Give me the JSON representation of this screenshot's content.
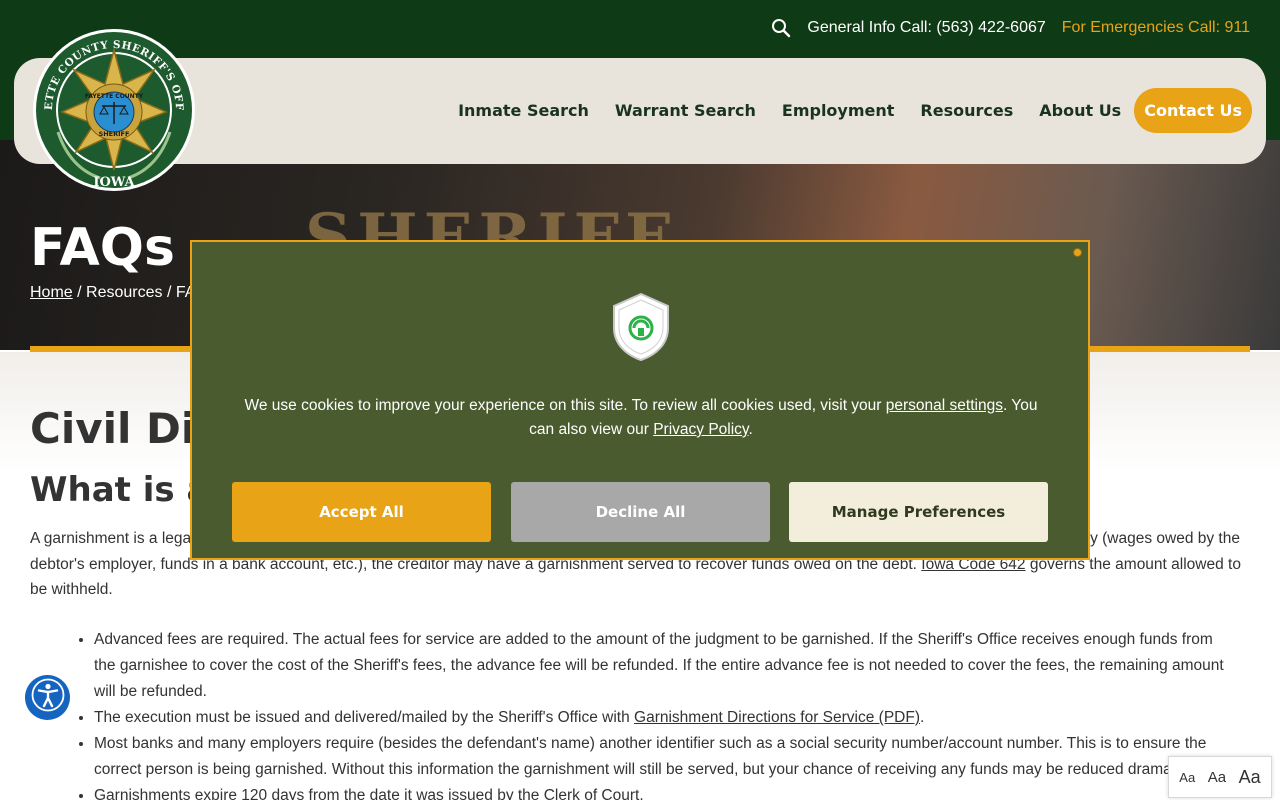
{
  "header": {
    "info_call": "General Info Call: (563) 422-6067",
    "emergency_call": "For Emergencies Call: 911",
    "search_icon": "search-icon"
  },
  "logo": {
    "top_text": "FAYETTE COUNTY SHERIFF'S OFFICE",
    "badge_top": "FAYETTE COUNTY",
    "badge_bottom": "SHERIFF",
    "bottom_text": "IOWA"
  },
  "nav": {
    "items": [
      "Inmate Search",
      "Warrant Search",
      "Employment",
      "Resources",
      "About Us"
    ],
    "contact": "Contact Us"
  },
  "hero": {
    "title": "FAQs",
    "background_word": "SHERIFF",
    "breadcrumb": {
      "home": "Home",
      "sep": "/",
      "resources": "Resources",
      "current": "FAQs"
    }
  },
  "content": {
    "heading": "Civil Division",
    "subheading": "What is a Garnishment?",
    "paragraph_lead": "A garnishment is a legal process in which a creditor who has obtained a judgment against a debtor can reach money, or property, in the hand of a third party (wages owed by the debtor's employer, funds in a bank account, etc.), the creditor may have a garnishment served to recover funds owed on the debt. ",
    "paragraph_link": "Iowa Code 642",
    "paragraph_tail": " governs the amount allowed to be withheld.",
    "bullets": [
      "Advanced fees are required. The actual fees for service are added to the amount of the judgment to be garnished. If the Sheriff's Office receives enough funds from the garnishee to cover the cost of the Sheriff's fees, the advance fee will be refunded. If the entire advance fee is not needed to cover the fees, the remaining amount will be refunded.",
      "The execution must be issued and delivered/mailed by the Sheriff's Office with ",
      "Most banks and many employers require (besides the defendant's name) another identifier such as a social security number/account number. This is to ensure the correct person is being garnished. Without this information the garnishment will still be served, but your chance of receiving any funds may be reduced dramatically.",
      "Garnishments expire 120 days from the date it was issued by the Clerk of Court."
    ],
    "bullet2_link": "Garnishment Directions for Service (PDF)",
    "bullet2_tail": "."
  },
  "cookie_modal": {
    "text_lead": "We use cookies to improve your experience on this site. To review all cookies used, visit your ",
    "settings_link": "personal settings",
    "text_mid": ". You can also view our ",
    "privacy_link": "Privacy Policy",
    "text_tail": ".",
    "accept": "Accept All",
    "decline": "Decline All",
    "manage": "Manage Preferences",
    "icon": "shield-icon"
  },
  "accessibility": {
    "icon": "accessibility-icon"
  },
  "font_size_widget": {
    "small": "Aa",
    "medium": "Aa",
    "large": "Aa"
  },
  "colors": {
    "brand_green": "#0f3a16",
    "accent_gold": "#e8a317",
    "modal_green": "#4a5b2f",
    "nav_bg": "#e8e3db"
  }
}
